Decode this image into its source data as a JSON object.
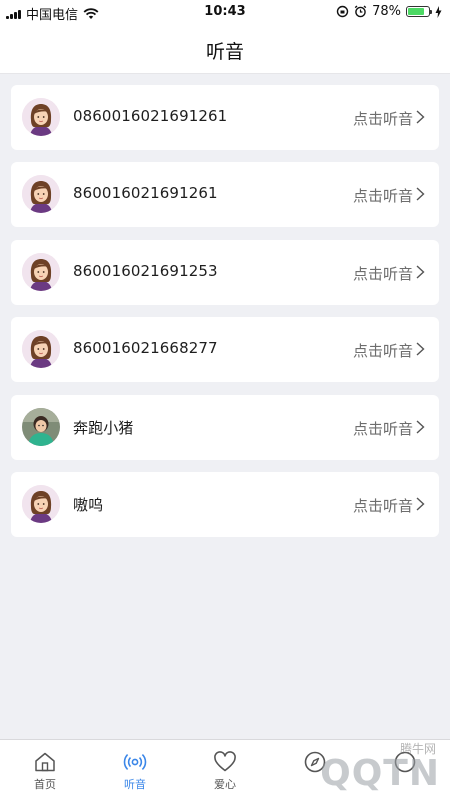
{
  "status_bar": {
    "carrier": "中国电信",
    "time": "10:43",
    "battery": "78%",
    "battery_level": 0.78
  },
  "header": {
    "title": "听音"
  },
  "devices": [
    {
      "name": "0860016021691261",
      "action": "点击听音",
      "avatar": "girl-avatar"
    },
    {
      "name": "860016021691261",
      "action": "点击听音",
      "avatar": "girl-avatar"
    },
    {
      "name": "860016021691253",
      "action": "点击听音",
      "avatar": "girl-avatar"
    },
    {
      "name": "860016021668277",
      "action": "点击听音",
      "avatar": "girl-avatar"
    },
    {
      "name": "奔跑小猪",
      "action": "点击听音",
      "avatar": "child-photo"
    },
    {
      "name": "嗷呜",
      "action": "点击听音",
      "avatar": "girl-avatar"
    }
  ],
  "tabbar": {
    "tabs": [
      {
        "label": "首页",
        "icon": "home-icon",
        "active": false
      },
      {
        "label": "听音",
        "icon": "broadcast-icon",
        "active": true
      },
      {
        "label": "爱心",
        "icon": "heart-icon",
        "active": false
      },
      {
        "label": "",
        "icon": "compass-icon",
        "active": false
      },
      {
        "label": "",
        "icon": "profile-icon",
        "active": false
      }
    ]
  },
  "watermark": {
    "small": "腾牛网",
    "big": "QQTN"
  },
  "colors": {
    "accent": "#3a86e8",
    "background": "#eff0f4",
    "card": "#ffffff"
  }
}
